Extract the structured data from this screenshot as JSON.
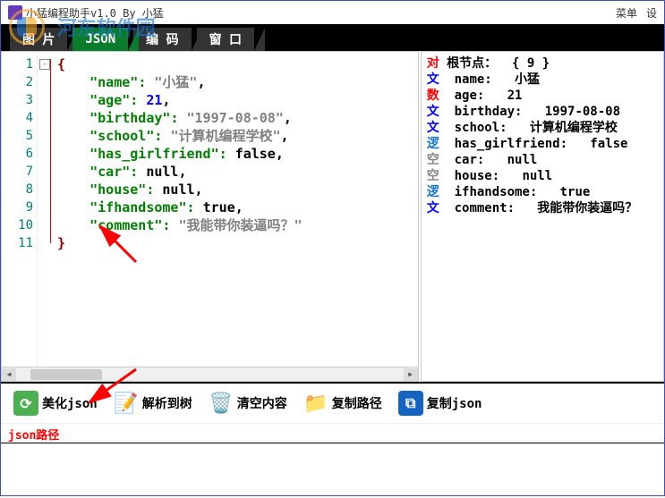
{
  "watermark": "河东软件园",
  "titlebar": {
    "title": "小猛编程助手v1.0     By 小猛",
    "menu1": "菜单",
    "menu2": "设"
  },
  "tabs": {
    "t1": "图 片",
    "t2": "JSON",
    "t3": "编 码",
    "t4": "窗 口"
  },
  "code": {
    "lines": [
      "1",
      "2",
      "3",
      "4",
      "5",
      "6",
      "7",
      "8",
      "9",
      "10",
      "11"
    ],
    "fold": "-",
    "open_brace": "{",
    "close_brace": "}",
    "entries": [
      {
        "k": "name",
        "v": "小猛",
        "type": "str"
      },
      {
        "k": "age",
        "v": "21",
        "type": "num"
      },
      {
        "k": "birthday",
        "v": "1997-08-08",
        "type": "str"
      },
      {
        "k": "school",
        "v": "计算机编程学校",
        "type": "str"
      },
      {
        "k": "has_girlfriend",
        "v": "false",
        "type": "bool"
      },
      {
        "k": "car",
        "v": "null",
        "type": "null"
      },
      {
        "k": "house",
        "v": "null",
        "type": "null"
      },
      {
        "k": "ifhandsome",
        "v": "true",
        "type": "bool"
      },
      {
        "k": "comment",
        "v": "我能带你装逼吗？",
        "type": "str"
      }
    ]
  },
  "tree": {
    "root_label": "根节点：",
    "root_count": "{ 9 }",
    "items": [
      {
        "tag": "文",
        "key": "name:",
        "val": "小猛"
      },
      {
        "tag": "数",
        "key": "age:",
        "val": "21"
      },
      {
        "tag": "文",
        "key": "birthday:",
        "val": "1997-08-08"
      },
      {
        "tag": "文",
        "key": "school:",
        "val": "计算机编程学校"
      },
      {
        "tag": "逻",
        "key": "has_girlfriend:",
        "val": "false"
      },
      {
        "tag": "空",
        "key": "car:",
        "val": "null"
      },
      {
        "tag": "空",
        "key": "house:",
        "val": "null"
      },
      {
        "tag": "逻",
        "key": "ifhandsome:",
        "val": "true"
      },
      {
        "tag": "文",
        "key": "comment:",
        "val": "我能带你装逼吗？"
      }
    ]
  },
  "toolbar": {
    "beautify": "美化json",
    "parse": "解析到树",
    "clear": "清空内容",
    "copypath": "复制路径",
    "copyjson": "复制json"
  },
  "pathbar": {
    "label": "json路径"
  }
}
